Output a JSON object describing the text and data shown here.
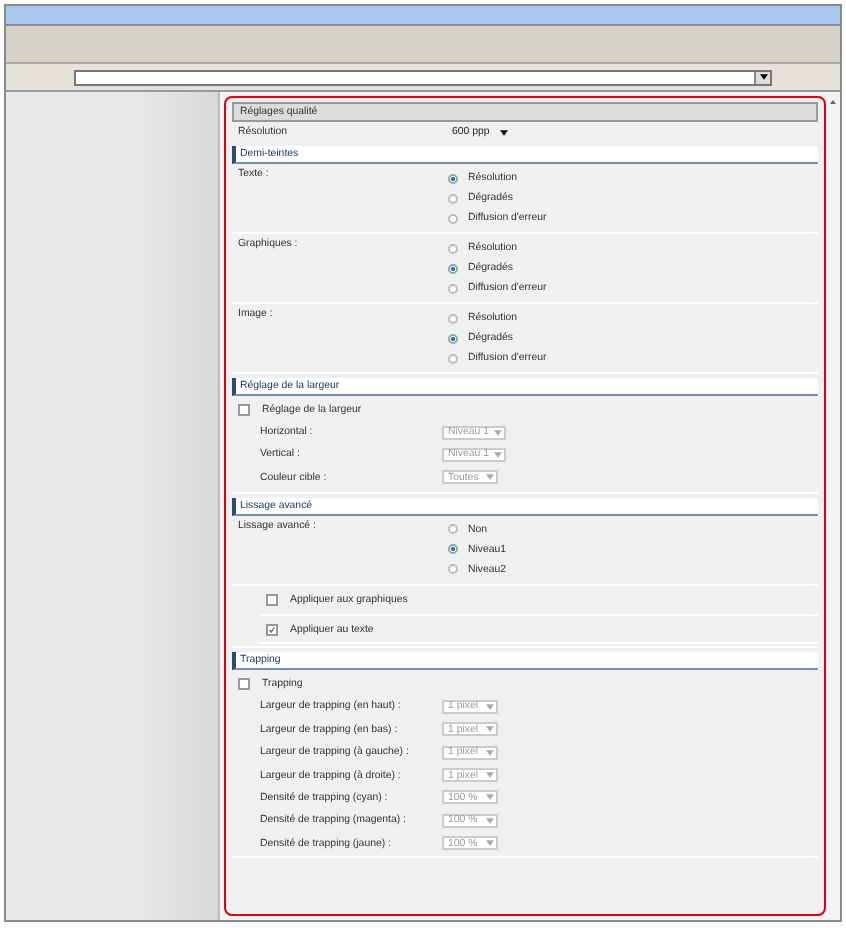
{
  "sections": [
    {
      "title": "Réglages qualité",
      "kind": "box",
      "rows": [
        {
          "kind": "select",
          "label": "Résolution",
          "value": "600 ppp",
          "disabled": false
        }
      ]
    },
    {
      "title": "Demi-teintes",
      "kind": "bar",
      "rows": [
        {
          "kind": "radio",
          "label": "Texte :",
          "options": [
            {
              "label": "Résolution",
              "selected": true
            },
            {
              "label": "Dégradés",
              "selected": false
            },
            {
              "label": "Diffusion d'erreur",
              "selected": false
            }
          ]
        },
        {
          "kind": "radio",
          "label": "Graphiques :",
          "options": [
            {
              "label": "Résolution",
              "selected": false
            },
            {
              "label": "Dégradés",
              "selected": true
            },
            {
              "label": "Diffusion d'erreur",
              "selected": false
            }
          ]
        },
        {
          "kind": "radio",
          "label": "Image :",
          "options": [
            {
              "label": "Résolution",
              "selected": false
            },
            {
              "label": "Dégradés",
              "selected": true
            },
            {
              "label": "Diffusion d'erreur",
              "selected": false
            }
          ]
        }
      ]
    },
    {
      "title": "Réglage de la largeur",
      "kind": "bar",
      "rows": [
        {
          "kind": "checkbox",
          "label": "Réglage de la largeur",
          "checked": false,
          "children": [
            {
              "kind": "select",
              "label": "Horizontal :",
              "value": "Niveau 1",
              "disabled": true
            },
            {
              "kind": "select",
              "label": "Vertical :",
              "value": "Niveau 1",
              "disabled": true
            },
            {
              "kind": "select",
              "label": "Couleur cible :",
              "value": "Toutes",
              "disabled": true
            }
          ]
        }
      ]
    },
    {
      "title": "Lissage avancé",
      "kind": "bar",
      "rows": [
        {
          "kind": "radio",
          "label": "Lissage avancé :",
          "options": [
            {
              "label": "Non",
              "selected": false
            },
            {
              "label": "Niveau1",
              "selected": true
            },
            {
              "label": "Niveau2",
              "selected": false
            }
          ]
        },
        {
          "kind": "group",
          "children": [
            {
              "kind": "checkbox",
              "label": "Appliquer aux graphiques",
              "checked": false
            },
            {
              "kind": "checkbox",
              "label": "Appliquer au texte",
              "checked": true
            }
          ]
        }
      ]
    },
    {
      "title": "Trapping",
      "kind": "bar",
      "rows": [
        {
          "kind": "checkbox",
          "label": "Trapping",
          "checked": false,
          "children": [
            {
              "kind": "select",
              "label": "Largeur de trapping (en haut) :",
              "value": "1 pixel",
              "disabled": true
            },
            {
              "kind": "select",
              "label": "Largeur de trapping (en bas) :",
              "value": "1 pixel",
              "disabled": true
            },
            {
              "kind": "select",
              "label": "Largeur de trapping (à gauche) :",
              "value": "1 pixel",
              "disabled": true
            },
            {
              "kind": "select",
              "label": "Largeur de trapping (à droite) :",
              "value": "1 pixel",
              "disabled": true
            },
            {
              "kind": "select",
              "label": "Densité de trapping (cyan) :",
              "value": "100 %",
              "disabled": true
            },
            {
              "kind": "select",
              "label": "Densité de trapping (magenta) :",
              "value": "100 %",
              "disabled": true
            },
            {
              "kind": "select",
              "label": "Densité de trapping (jaune) :",
              "value": "100 %",
              "disabled": true
            }
          ]
        }
      ]
    }
  ]
}
